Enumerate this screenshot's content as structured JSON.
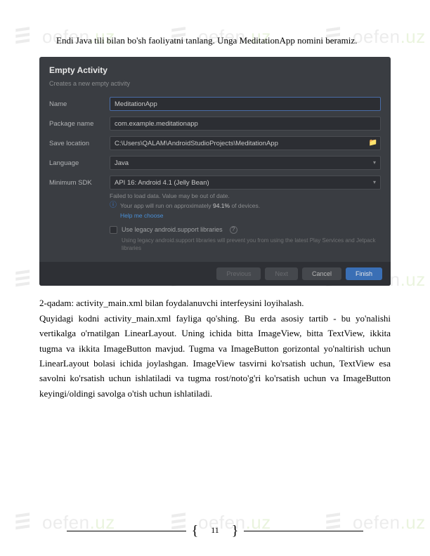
{
  "watermark": {
    "text_plain": "oefen",
    "text_suffix": ".uz"
  },
  "intro": {
    "text": "Endi Java tili bilan bo'sh faoliyatni tanlang. Unga MeditationApp nomini beramiz."
  },
  "dialog": {
    "title": "Empty Activity",
    "subtitle": "Creates a new empty activity",
    "rows": {
      "name": {
        "label": "Name",
        "value": "MeditationApp"
      },
      "package": {
        "label": "Package name",
        "value": "com.example.meditationapp"
      },
      "save": {
        "label": "Save location",
        "value": "C:\\Users\\QALAM\\AndroidStudioProjects\\MeditationApp"
      },
      "language": {
        "label": "Language",
        "value": "Java"
      },
      "minsdk": {
        "label": "Minimum SDK",
        "value": "API 16: Android 4.1 (Jelly Bean)"
      }
    },
    "info": {
      "line1": "Failed to load data. Value may be out of date.",
      "line2_prefix": "Your app will run on approximately ",
      "line2_pct": "94.1%",
      "line2_suffix": " of devices.",
      "link": "Help me choose"
    },
    "checkbox": {
      "label": "Use legacy android.support libraries"
    },
    "legacy_note": "Using legacy android.support libraries will prevent you from using the latest Play Services and Jetpack libraries",
    "buttons": {
      "previous": "Previous",
      "next": "Next",
      "cancel": "Cancel",
      "finish": "Finish"
    }
  },
  "body": {
    "step_title": "2-qadam: activity_main.xml bilan foydalanuvchi interfeysini loyihalash.",
    "para": "Quyidagi kodni activity_main.xml fayliga qo'shing. Bu erda asosiy tartib - bu yo'nalishi vertikalga o'rnatilgan LinearLayout. Uning ichida bitta ImageView, bitta TextView, ikkita tugma va ikkita ImageButton mavjud. Tugma va ImageButton gorizontal yo'naltirish uchun LinearLayout bolasi ichida joylashgan. ImageView tasvirni ko'rsatish uchun, TextView esa savolni ko'rsatish uchun ishlatiladi va tugma rost/noto'g'ri ko'rsatish uchun va ImageButton keyingi/oldingi savolga o'tish uchun ishlatiladi."
  },
  "page_number": "11"
}
